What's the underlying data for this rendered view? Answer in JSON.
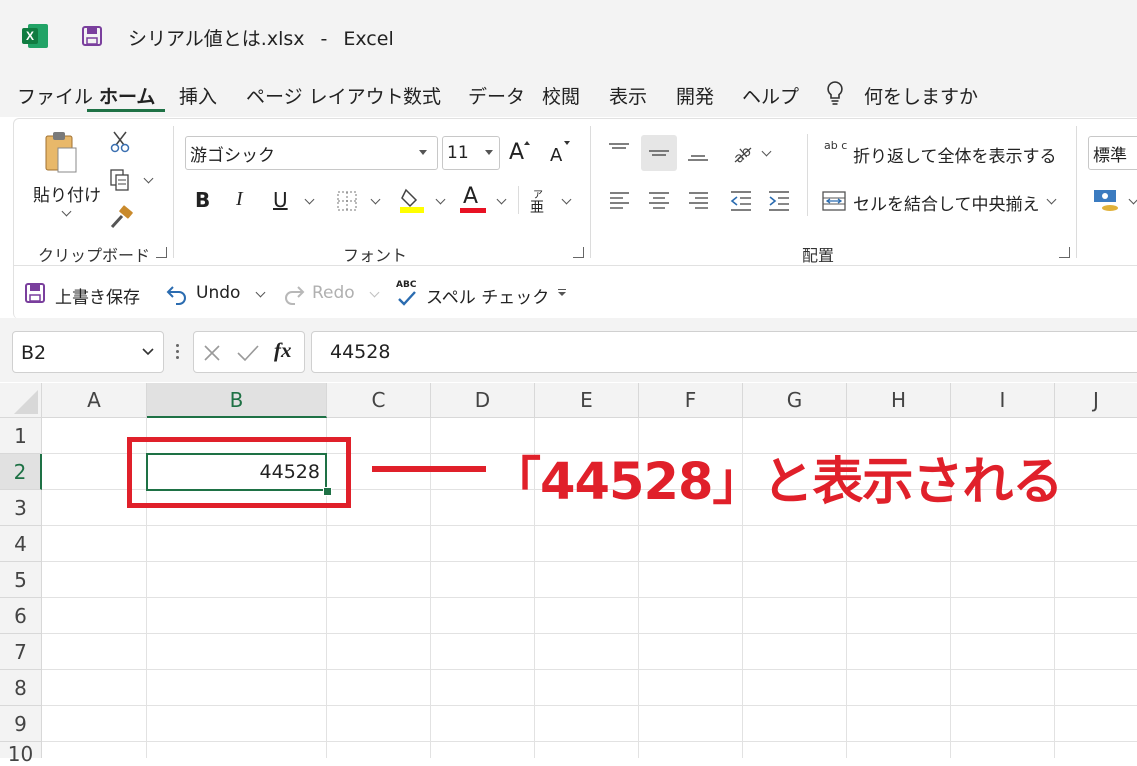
{
  "title_bar": {
    "file_name": "シリアル値とは.xlsx",
    "separator": "-",
    "app_name": "Excel",
    "app_icon_letter": "X"
  },
  "menu": {
    "items": [
      "ファイル",
      "ホーム",
      "挿入",
      "ページ レイアウト",
      "数式",
      "データ",
      "校閲",
      "表示",
      "開発",
      "ヘルプ"
    ],
    "active": "ホーム",
    "search_label": "何をしますか"
  },
  "ribbon": {
    "clipboard": {
      "paste_label": "貼り付け",
      "group_label": "クリップボード"
    },
    "font": {
      "font_name": "游ゴシック",
      "font_size": "11",
      "bold": "B",
      "italic": "I",
      "underline": "U",
      "grow_glyph": "A",
      "shrink_glyph": "A",
      "font_color_glyph": "A",
      "furigana_top": "ア",
      "furigana_bottom": "亜",
      "group_label": "フォント"
    },
    "alignment": {
      "wrap_label": "折り返して全体を表示する",
      "wrap_icon_text": "ab c",
      "merge_label": "セルを結合して中央揃え",
      "group_label": "配置"
    },
    "number": {
      "format": "標準"
    },
    "accent_colors": {
      "highlight": "#ffff00",
      "font_color": "#e81123",
      "excel_green": "#1e7145"
    }
  },
  "quick_access": {
    "save_label": "上書き保存",
    "undo_label": "Undo",
    "redo_label": "Redo",
    "spell_label": "スペル チェック",
    "spell_icon_text": "ABC"
  },
  "formula_bar": {
    "name_box": "B2",
    "fx": "fx",
    "value": "44528"
  },
  "sheet": {
    "columns": [
      "A",
      "B",
      "C",
      "D",
      "E",
      "F",
      "G",
      "H",
      "I",
      "J"
    ],
    "rows": [
      "1",
      "2",
      "3",
      "4",
      "5",
      "6",
      "7",
      "8",
      "9",
      "10"
    ],
    "active_cell": "B2",
    "cell_b2_value": "44528"
  },
  "annotation": {
    "text": "「44528」と表示される",
    "color": "#e0202a"
  }
}
